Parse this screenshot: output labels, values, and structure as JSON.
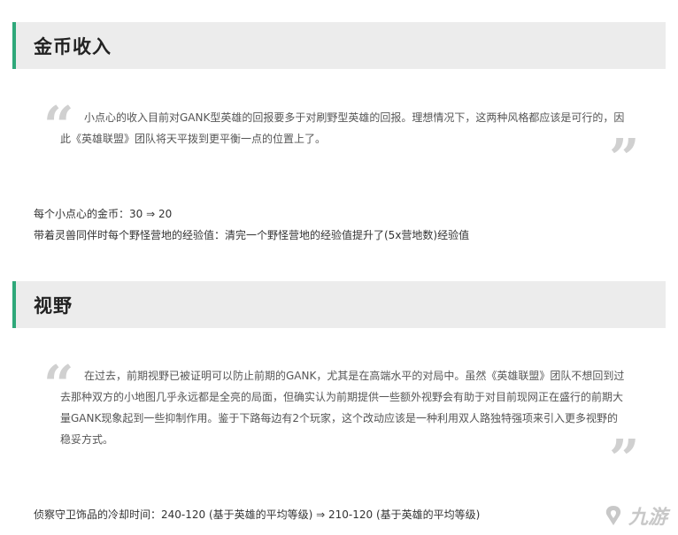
{
  "sections": [
    {
      "title": "金币收入",
      "quote": "小点心的收入目前对GANK型英雄的回报要多于对刷野型英雄的回报。理想情况下，这两种风格都应该是可行的，因此《英雄联盟》团队将天平拨到更平衡一点的位置上了。",
      "lines": [
        "每个小点心的金币：30 ⇒ 20",
        "带着灵兽同伴时每个野怪营地的经验值：清完一个野怪营地的经验值提升了(5x营地数)经验值"
      ]
    },
    {
      "title": "视野",
      "quote": "在过去，前期视野已被证明可以防止前期的GANK，尤其是在高端水平的对局中。虽然《英雄联盟》团队不想回到过去那种双方的小地图几乎永远都是全亮的局面，但确实认为前期提供一些额外视野会有助于对目前现网正在盛行的前期大量GANK现象起到一些抑制作用。鉴于下路每边有2个玩家，这个改动应该是一种利用双人路独特强项来引入更多视野的稳妥方式。",
      "lines": [
        "侦察守卫饰品的冷却时间：240-120 (基于英雄的平均等级) ⇒ 210-120 (基于英雄的平均等级)"
      ]
    }
  ],
  "quote_marks": {
    "open": "“",
    "close": "”"
  },
  "watermark": {
    "text": "九游",
    "icon": "jiuyou-logo-icon"
  },
  "colors": {
    "accent": "#2ea87a",
    "header_bg": "#ececec",
    "quote_mark": "#d0d0d0"
  }
}
